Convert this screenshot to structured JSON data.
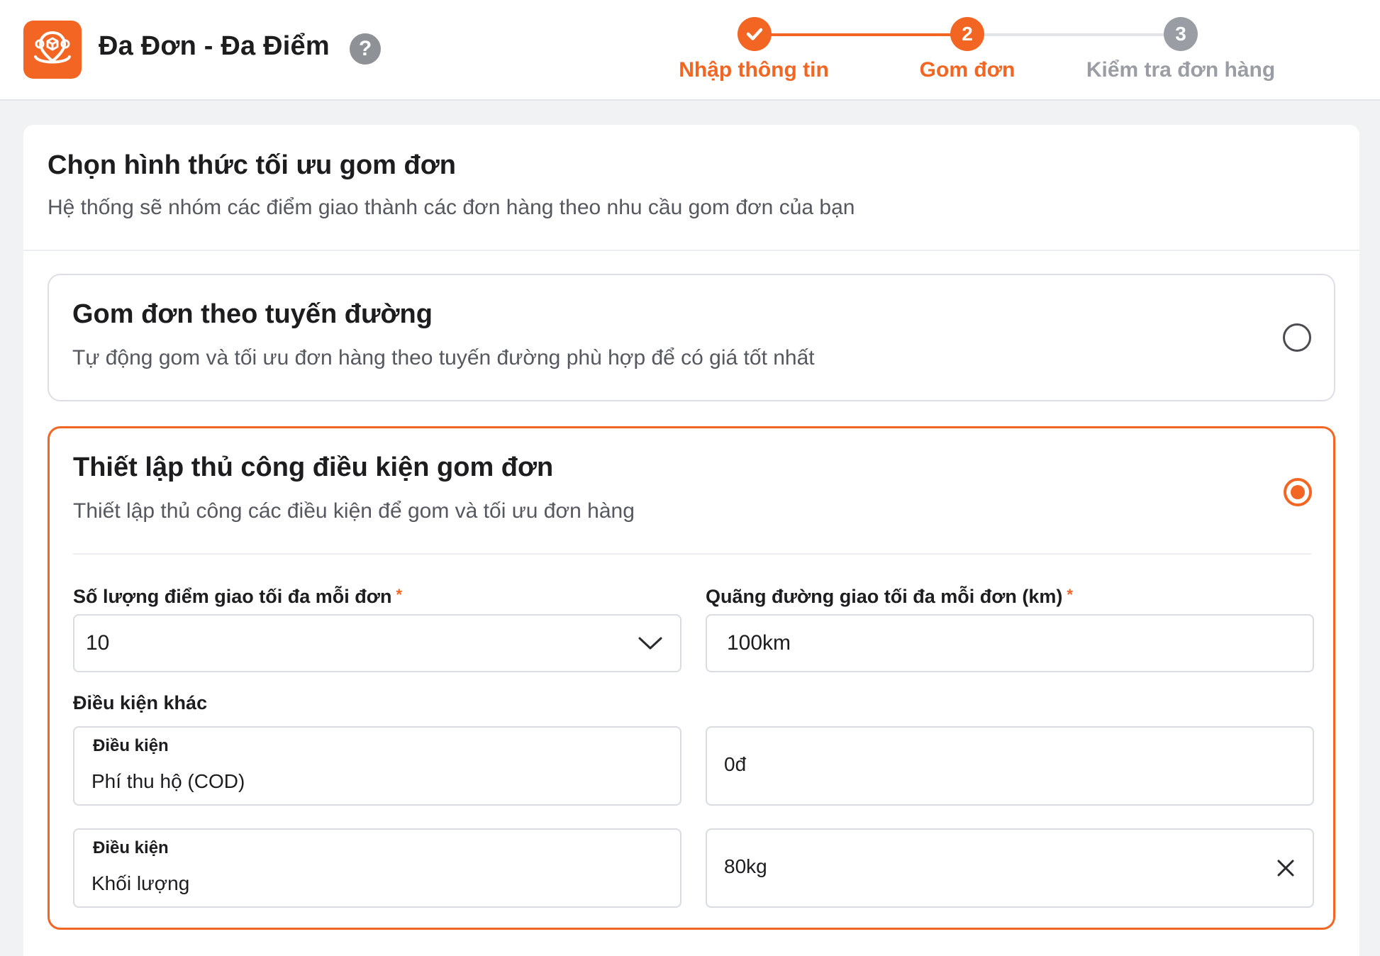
{
  "header": {
    "app_title": "Đa Đơn - Đa Điểm",
    "help_icon": "question-circle-icon",
    "logo_icon": "location-package-logo"
  },
  "stepper": {
    "steps": [
      {
        "number": "✓",
        "label": "Nhập thông tin",
        "state": "done"
      },
      {
        "number": "2",
        "label": "Gom đơn",
        "state": "active"
      },
      {
        "number": "3",
        "label": "Kiểm tra đơn hàng",
        "state": "pending"
      }
    ]
  },
  "section": {
    "title": "Chọn hình thức tối ưu gom đơn",
    "subtitle": "Hệ thống sẽ nhóm các điểm giao thành các đơn hàng theo nhu cầu gom đơn của bạn"
  },
  "options": [
    {
      "title": "Gom đơn theo tuyến đường",
      "subtitle": "Tự động gom và tối ưu đơn hàng theo tuyến đường phù hợp để có giá tốt nhất",
      "selected": false
    },
    {
      "title": "Thiết lập thủ công điều kiện gom đơn",
      "subtitle": "Thiết lập thủ công các điều kiện để gom và tối ưu đơn hàng",
      "selected": true
    }
  ],
  "form": {
    "max_points_label": "Số lượng điểm giao tối đa mỗi đơn",
    "max_points_value": "10",
    "max_distance_label": "Quãng đường giao tối đa mỗi đơn (km)",
    "max_distance_value": "100km",
    "required_mark": "*",
    "other_conditions_label": "Điều kiện khác",
    "conditions": [
      {
        "label": "Điều kiện",
        "type": "Phí thu hộ (COD)",
        "value": "0đ",
        "clearable": false
      },
      {
        "label": "Điều kiện",
        "type": "Khối lượng",
        "value": "80kg",
        "clearable": true
      }
    ]
  },
  "colors": {
    "accent": "#f26522",
    "pending": "#9a9da3",
    "line_pending": "#e2e4e8"
  }
}
